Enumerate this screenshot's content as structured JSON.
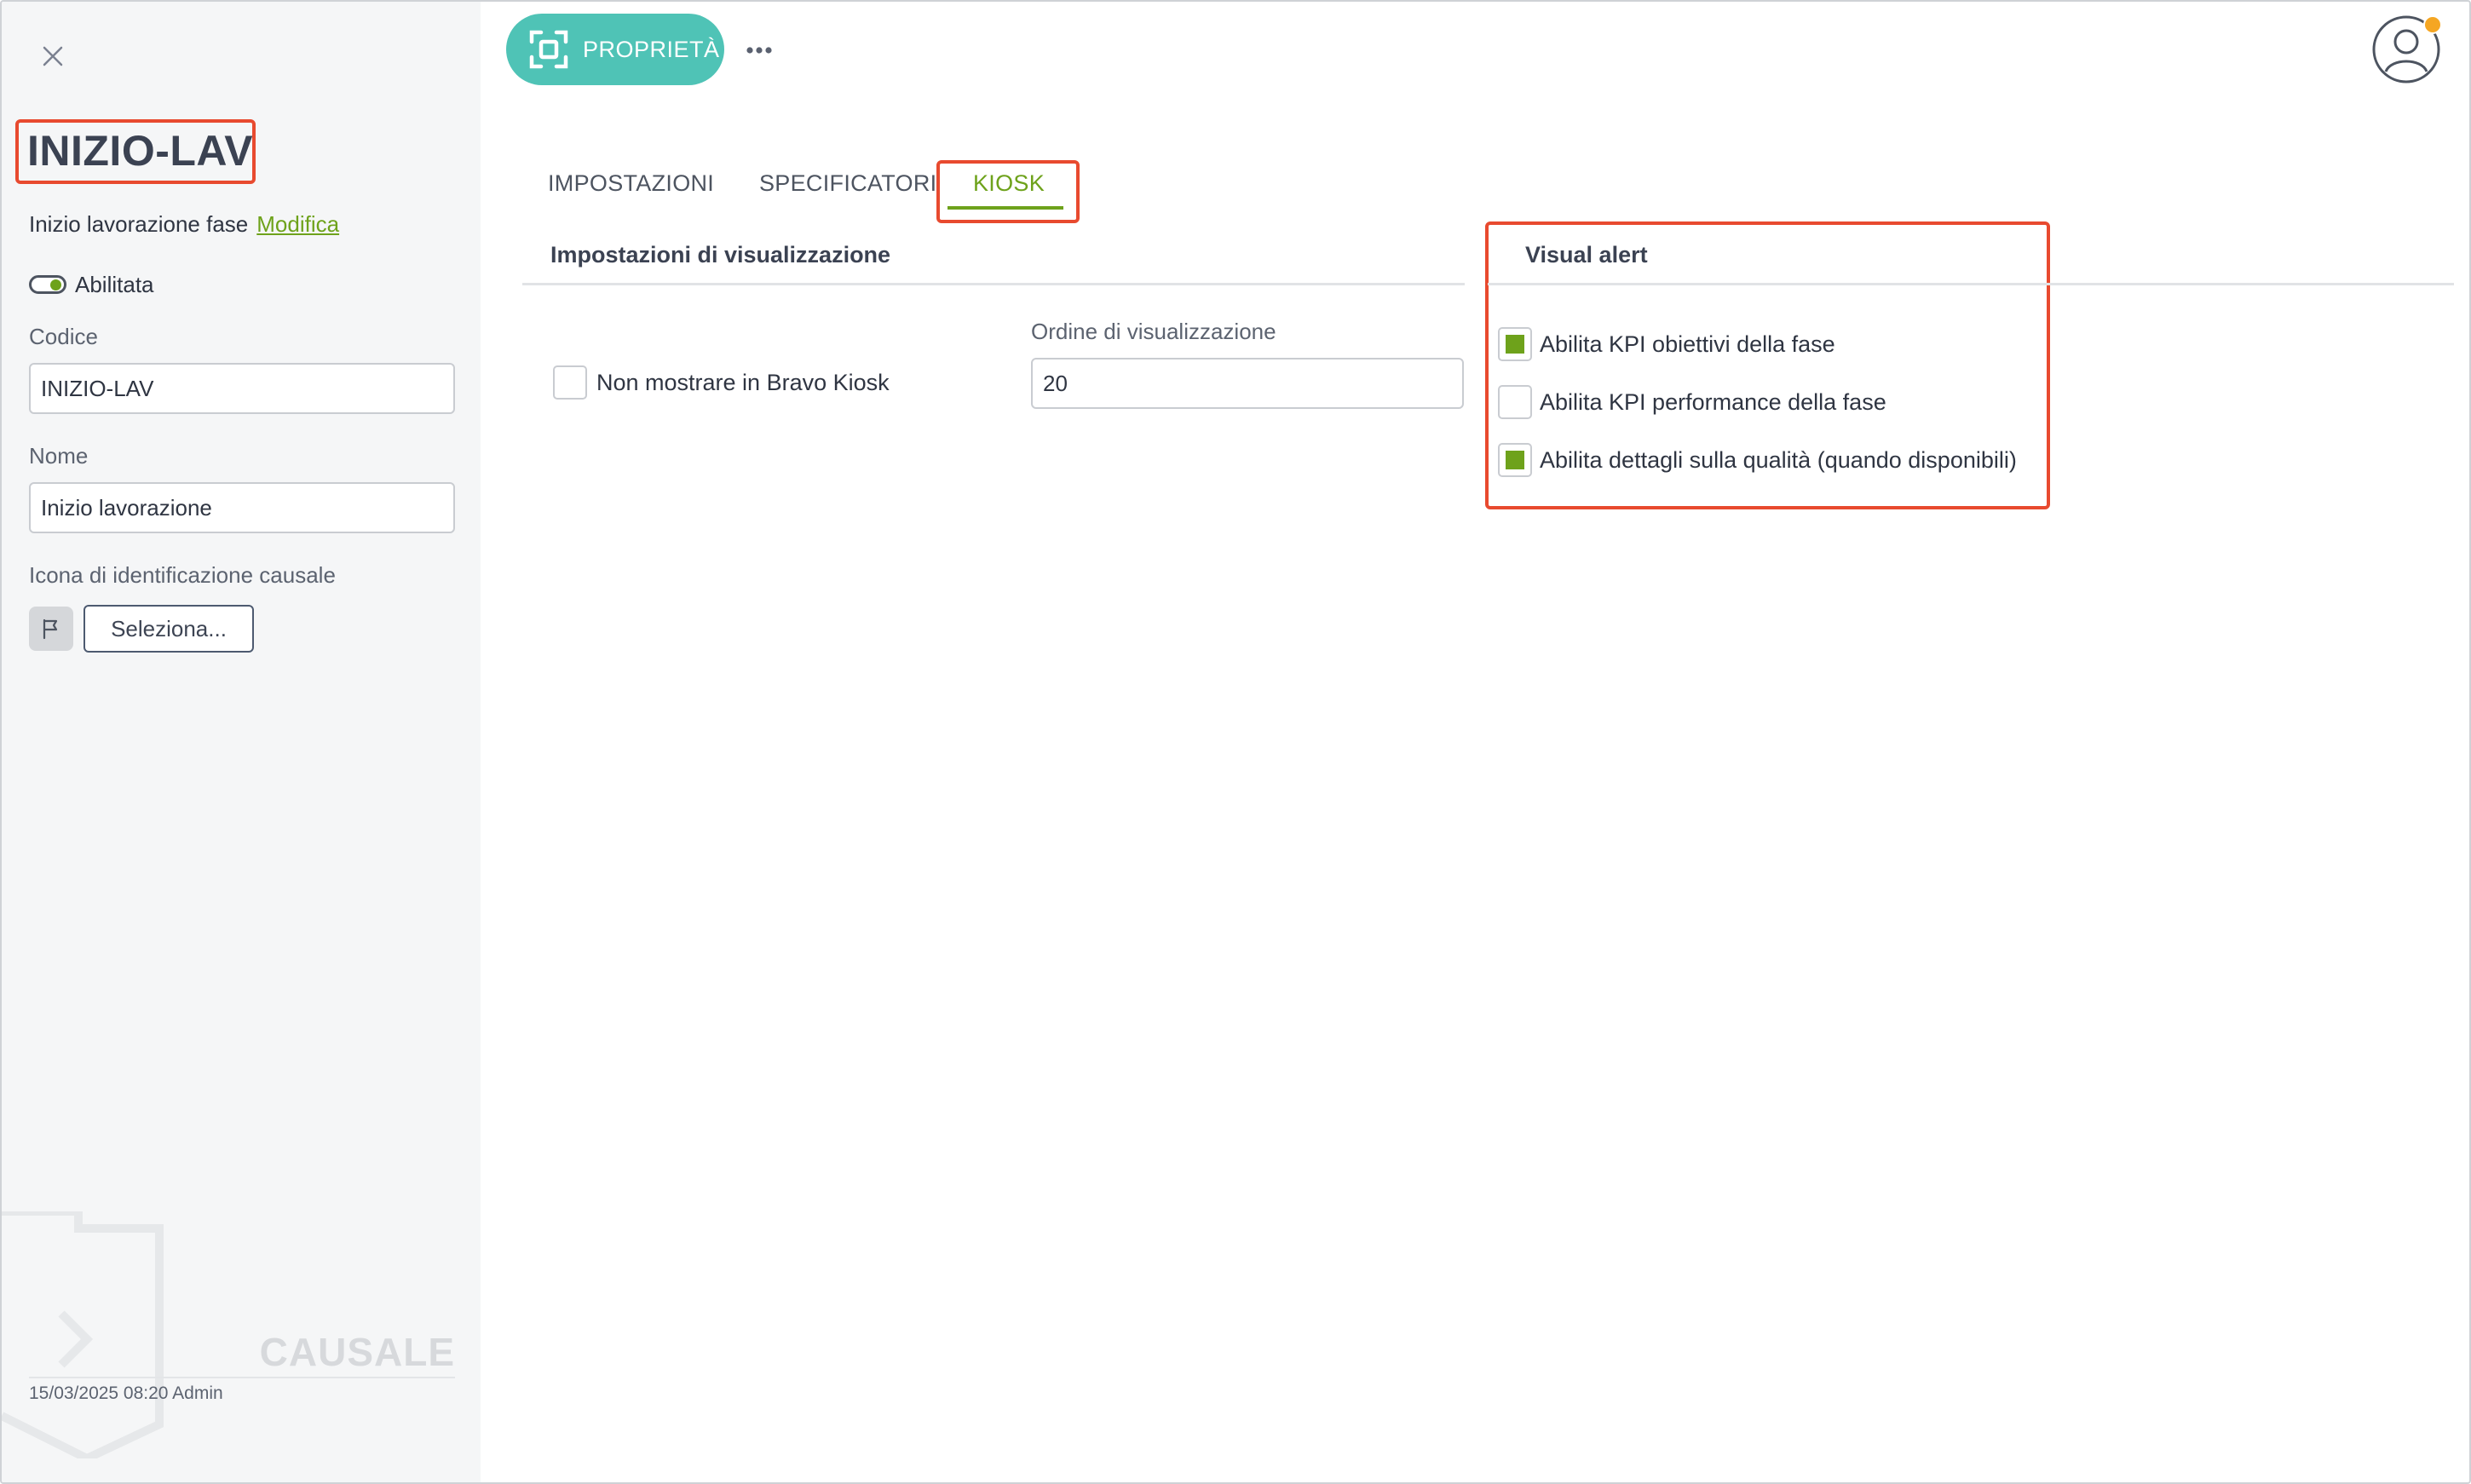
{
  "sidebar": {
    "title": "INIZIO-LAV",
    "description": "Inizio lavorazione fase",
    "edit_link": "Modifica",
    "enabled_label": "Abilitata",
    "enabled": true,
    "code_label": "Codice",
    "code_value": "INIZIO-LAV",
    "name_label": "Nome",
    "name_value": "Inizio lavorazione",
    "icon_label": "Icona di identificazione causale",
    "icon": "flag-icon",
    "select_button": "Seleziona...",
    "entity_type": "CAUSALE",
    "footer_meta": "15/03/2025 08:20 Admin"
  },
  "toolbar": {
    "properties_button": "PROPRIETÀ",
    "more_icon": "ellipsis-icon",
    "avatar_icon": "user-icon"
  },
  "tabs": [
    {
      "label": "IMPOSTAZIONI",
      "active": false
    },
    {
      "label": "SPECIFICATORI",
      "active": false
    },
    {
      "label": "KIOSK",
      "active": true
    }
  ],
  "display_settings": {
    "title": "Impostazioni di visualizzazione",
    "hide_in_kiosk_label": "Non mostrare in Bravo Kiosk",
    "hide_in_kiosk_checked": false,
    "order_label": "Ordine di visualizzazione",
    "order_value": "20"
  },
  "visual_alert": {
    "title": "Visual alert",
    "options": [
      {
        "label": "Abilita KPI obiettivi della fase",
        "checked": true
      },
      {
        "label": "Abilita KPI performance della fase",
        "checked": false
      },
      {
        "label": "Abilita dettagli sulla qualità (quando disponibili)",
        "checked": true
      }
    ]
  },
  "colors": {
    "accent_green": "#6ea21b",
    "teal_button": "#4fc3b6",
    "highlight_red": "#e84a2f",
    "badge_orange": "#f5a623"
  }
}
